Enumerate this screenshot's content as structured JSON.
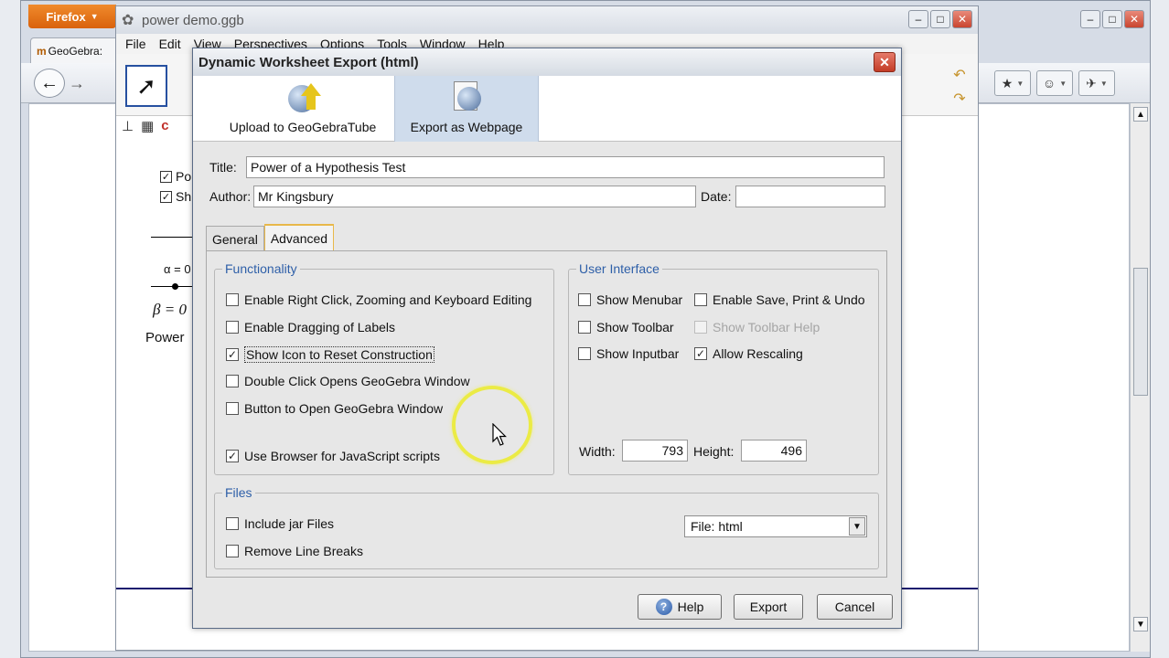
{
  "firefox": {
    "menu_label": "Firefox",
    "tab_label": "GeoGebra:",
    "tab_icon_glyph": "m"
  },
  "geogebra": {
    "window_title": "power demo.ggb",
    "menu": [
      "File",
      "Edit",
      "View",
      "Perspectives",
      "Options",
      "Tools",
      "Window",
      "Help"
    ],
    "checkbox_1": "Po",
    "checkbox_2": "Sh",
    "alpha_text": "α = 0",
    "beta_text": "β = 0",
    "power_text": "Power"
  },
  "dialog": {
    "title": "Dynamic Worksheet Export (html)",
    "ribbon": {
      "upload_label": "Upload to GeoGebraTube",
      "export_label": "Export as Webpage"
    },
    "title_label": "Title:",
    "title_value": "Power of a Hypothesis Test",
    "author_label": "Author:",
    "author_value": "Mr Kingsbury",
    "date_label": "Date:",
    "date_value": "",
    "tabs": {
      "general": "General",
      "advanced": "Advanced"
    },
    "functionality": {
      "title": "Functionality",
      "items": [
        {
          "label": "Enable Right Click, Zooming and Keyboard Editing",
          "checked": false
        },
        {
          "label": "Enable Dragging of Labels",
          "checked": false
        },
        {
          "label": "Show Icon to Reset Construction",
          "checked": true
        },
        {
          "label": "Double Click Opens GeoGebra Window",
          "checked": false
        },
        {
          "label": "Button to Open GeoGebra Window",
          "checked": false
        },
        {
          "label": "Use Browser for JavaScript scripts",
          "checked": true
        }
      ]
    },
    "user_interface": {
      "title": "User Interface",
      "items": [
        {
          "label": "Show Menubar",
          "checked": false
        },
        {
          "label": "Enable Save, Print & Undo",
          "checked": false
        },
        {
          "label": "Show Toolbar",
          "checked": false
        },
        {
          "label": "Show Toolbar Help",
          "checked": false
        },
        {
          "label": "Show Inputbar",
          "checked": false
        },
        {
          "label": "Allow Rescaling",
          "checked": true
        }
      ],
      "width_label": "Width:",
      "width_value": "793",
      "height_label": "Height:",
      "height_value": "496"
    },
    "files": {
      "title": "Files",
      "include_jar": "Include jar Files",
      "remove_breaks": "Remove Line Breaks",
      "file_type": "File: html"
    },
    "buttons": {
      "help": "Help",
      "export": "Export",
      "cancel": "Cancel"
    }
  },
  "colors": {
    "group_title": "#2e5fa8",
    "tab_highlight": "#e8b84a",
    "ribbon_selected": "#cfdcec"
  }
}
